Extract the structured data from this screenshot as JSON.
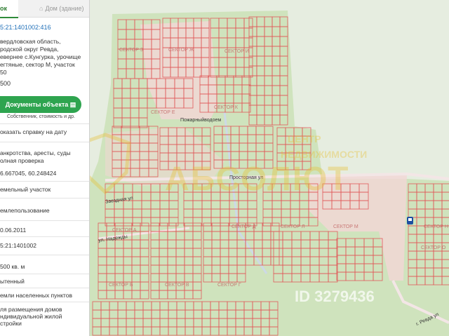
{
  "tabs": [
    {
      "label": "ок",
      "active": true
    },
    {
      "label": "Дом (здание)",
      "icon": "house-icon",
      "active": false
    }
  ],
  "cadastral_number": "5:21:1401002:416",
  "address_lines": "вердловская область,\nродской округ Ревда,\nевернее с.Кунгурка, урочище\nегтяные, сектор М, участок\n50",
  "area_value": "500",
  "documents_button": "Документы объекта",
  "documents_sub": "Собственник, стоимость и др.",
  "certificate_link": "оказать справку на дату",
  "checks_text": "анкротства, аресты, суды",
  "full_check_link": "олная проверка",
  "coordinates": "6.667045, 60.248424",
  "object_type": "емельный участок",
  "ownership_form": "емлепользование",
  "reg_date": "0.06.2011",
  "quarter": "5:21:1401002",
  "area_full": "500 кв. м",
  "status": "ытенный",
  "category": "емли населенных пунктов",
  "usage": "ля размещения домов\nндивидуальной жилой\nстройки",
  "map_labels": {
    "sector_a": "СЕКТОР А",
    "sector_b": "СЕКТОР Б",
    "sector_c": "СЕКТОР В",
    "sector_e": "СЕКТОР Е",
    "sector_g": "СЕКТОР Г",
    "sector_d": "СЕКТОР Д",
    "sector_zh": "СЕКТОР Ж",
    "sector_z": "СЕКТОР З",
    "sector_i": "СЕКТОР И",
    "sector_k": "СЕКТОР К",
    "sector_l": "СЕКТОР Л",
    "sector_m": "СЕКТОР М",
    "sector_n": "СЕКТОР Н",
    "sector_o": "СЕКТОР О",
    "fire_pond": "Пожарныйводоем",
    "street_prostornaya": "Просторная ул",
    "street_zaezdnaya": "Заездная ул",
    "street_nadezhdy": "ул. Надежды",
    "street_right": "г. Ревда ул"
  },
  "watermark": {
    "logo": "АБСОЛЮТ",
    "line1": "ЦЕНТР",
    "line2": "НЕДВИЖИМОСТИ",
    "id": "ID 3279436"
  },
  "colors": {
    "accent_green": "#2ea44f",
    "link_blue": "#1f6fb8",
    "parcel_line": "#e05a5a",
    "map_green": "#cfe3bd",
    "forest": "#e6ede0"
  }
}
